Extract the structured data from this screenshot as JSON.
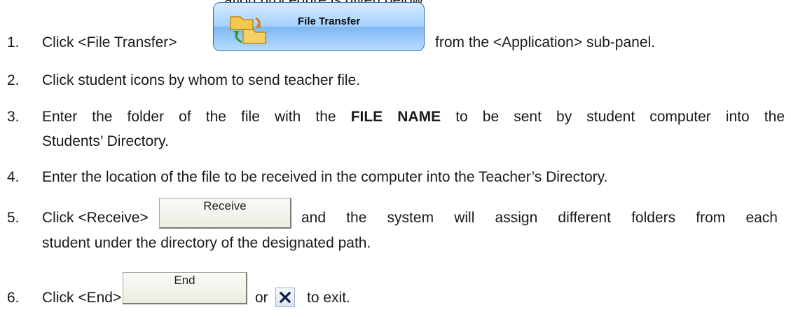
{
  "top_cut_text": "ation procedure is given below",
  "file_transfer_button": {
    "label": "File Transfer"
  },
  "receive_button": {
    "label": "Receive"
  },
  "end_button": {
    "label": "End"
  },
  "steps": [
    {
      "num": "1.",
      "a": "Click <File Transfer>",
      "b": "from the <Application> sub-panel."
    },
    {
      "num": "2.",
      "a": "Click student icons by whom to send teacher file."
    },
    {
      "num": "3.",
      "a": "Enter the folder of the file with the",
      "bold": "FILE NAME",
      "b": "to be sent by student computer into the",
      "c": "Students’ Directory."
    },
    {
      "num": "4.",
      "a": "Enter the location of the file to be received in the computer into the Teacher’s Directory."
    },
    {
      "num": "5.",
      "a": "Click <Receive>",
      "b": "and the system will assign different folders from each",
      "c": "student under the directory of the designated path."
    },
    {
      "num": "6.",
      "a": "Click <End>",
      "b": "or",
      "c": "to exit."
    }
  ]
}
